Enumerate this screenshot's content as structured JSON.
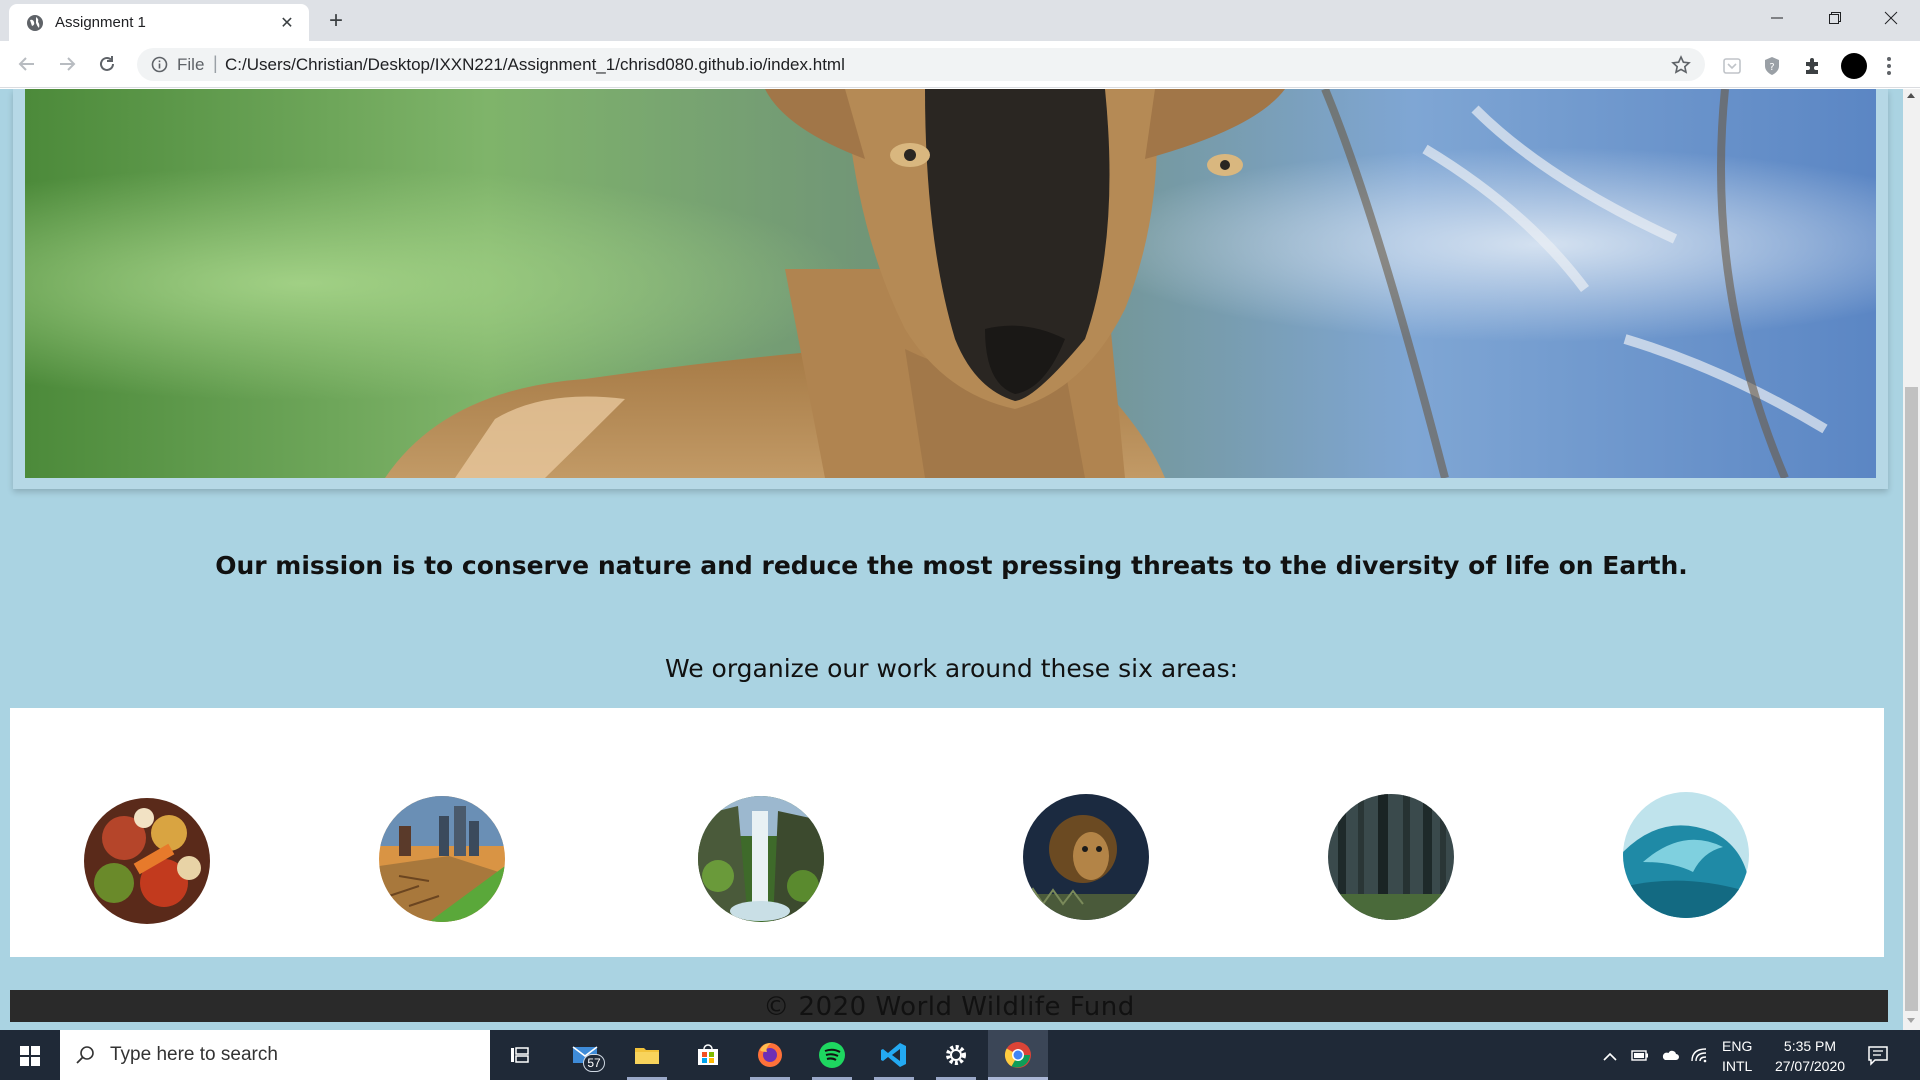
{
  "browser": {
    "tab_title": "Assignment 1",
    "tab_close": "✕",
    "new_tab": "+",
    "url_scheme": "File",
    "url_separator": "|",
    "url": "C:/Users/Christian/Desktop/IXXN221/Assignment_1/chrisd080.github.io/index.html"
  },
  "page": {
    "mission": "Our mission is to conserve nature and reduce the most pressing threats to the diversity of life on Earth.",
    "areas_heading": "We organize our work around these six areas:",
    "areas": [
      {
        "icon": "food-icon"
      },
      {
        "icon": "climate-icon"
      },
      {
        "icon": "freshwater-icon"
      },
      {
        "icon": "wildlife-icon"
      },
      {
        "icon": "forests-icon"
      },
      {
        "icon": "oceans-icon"
      }
    ],
    "footer": "© 2020 World Wildlife Fund",
    "background_color": "#aad3e2"
  },
  "taskbar": {
    "search_placeholder": "Type here to search",
    "mail_badge": "57",
    "language_line1": "ENG",
    "language_line2": "INTL",
    "time": "5:35 PM",
    "date": "27/07/2020"
  }
}
